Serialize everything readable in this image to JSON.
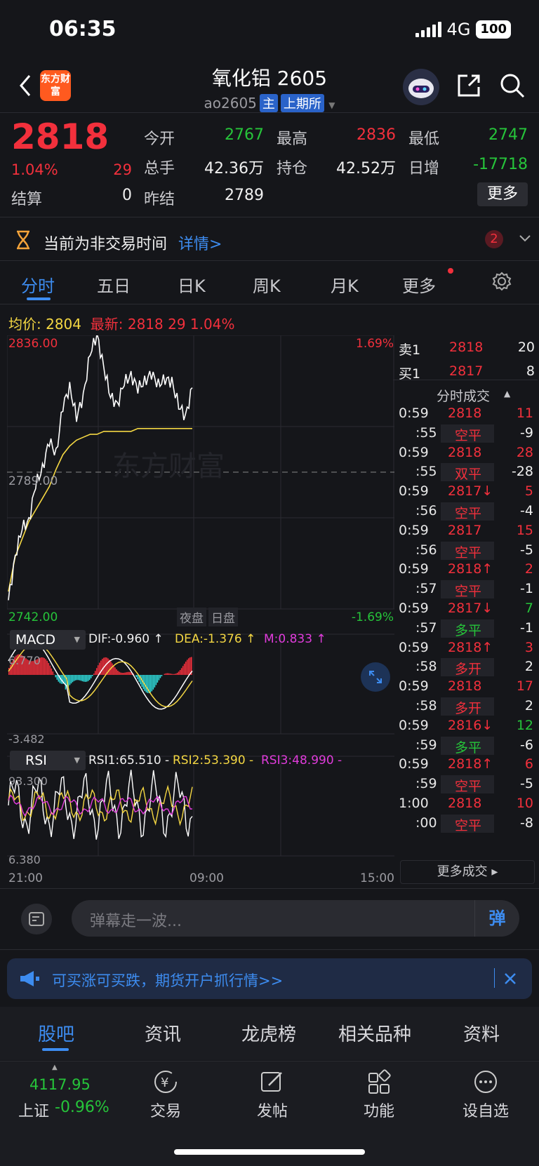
{
  "status_bar": {
    "time": "06:35",
    "network": "4G",
    "battery": "100"
  },
  "header": {
    "logo_text": "东方财富",
    "title": "氧化铝 2605",
    "code": "ao2605",
    "tag_main": "主",
    "tag_exchange": "上期所"
  },
  "quote": {
    "price": "2818",
    "change_pct": "1.04%",
    "change": "29",
    "settle_label": "结算",
    "settle_value": "0",
    "open_label": "今开",
    "open_value": "2767",
    "high_label": "最高",
    "high_value": "2836",
    "low_label": "最低",
    "low_value": "2747",
    "volume_label": "总手",
    "volume_value": "42.36万",
    "oi_label": "持仓",
    "oi_value": "42.52万",
    "daily_inc_label": "日增",
    "daily_inc_value": "-17718",
    "prev_settle_label": "昨结",
    "prev_settle_value": "2789",
    "more_label": "更多"
  },
  "notice": {
    "text": "当前为非交易时间",
    "link": "详情>",
    "badge": "2"
  },
  "tabs": [
    "分时",
    "五日",
    "日K",
    "周K",
    "月K",
    "更多"
  ],
  "avg_line": {
    "avg_label": "均价:",
    "avg_value": "2804",
    "latest_label": "最新:",
    "latest_value": "2818",
    "latest_change": "29",
    "latest_pct": "1.04%"
  },
  "chart": {
    "y_high": "2836.00",
    "y_mid": "2789.00",
    "y_low": "2742.00",
    "pct_high": "1.69%",
    "pct_low": "-1.69%",
    "night_label": "夜盘",
    "day_label": "日盘",
    "watermark": "东方财富",
    "time_labels": [
      "21:00",
      "09:00",
      "15:00"
    ],
    "macd": {
      "selector": "MACD",
      "dif": "DIF:-0.960 ↑",
      "dea": "DEA:-1.376 ↑",
      "m": "M:0.833 ↑",
      "y_high": "6.770",
      "y_low": "-3.482"
    },
    "rsi": {
      "selector": "RSI",
      "rsi1": "RSI1:65.510 -",
      "rsi2": "RSI2:53.390 -",
      "rsi3": "RSI3:48.990 -",
      "y_high": "93.300",
      "y_low": "6.380"
    },
    "colors": {
      "price": "#ffffff",
      "avg": "#f4d743",
      "up": "#f2303c",
      "down": "#2fd7d7",
      "rsi3": "#e13cdc"
    }
  },
  "chart_data": {
    "type": "line",
    "title": "",
    "y_range": [
      2742.0,
      2836.0
    ],
    "ref_price": 2789.0,
    "x_labels": [
      "21:00",
      "09:00",
      "15:00"
    ],
    "series": [
      {
        "values": [
          2745,
          2760,
          2770,
          2772,
          2785,
          2790,
          2800,
          2795,
          2812,
          2818,
          2808,
          2815,
          2830,
          2836,
          2825,
          2815,
          2812,
          2820,
          2822,
          2818,
          2820,
          2823,
          2819,
          2821,
          2820,
          2812,
          2808,
          2818
        ]
      },
      {
        "values": [
          2748,
          2760,
          2766,
          2772,
          2776,
          2780,
          2784,
          2790,
          2795,
          2798,
          2800,
          2801,
          2802,
          2802,
          2803,
          2803,
          2803,
          2803,
          2803,
          2804,
          2804,
          2804,
          2804,
          2804,
          2804,
          2804,
          2804,
          2804
        ]
      }
    ]
  },
  "order_book": {
    "sell_label": "卖1",
    "sell_price": "2818",
    "sell_vol": "20",
    "buy_label": "买1",
    "buy_price": "2817",
    "buy_vol": "8",
    "ticks_title": "分时成交",
    "ticks": [
      {
        "t": "0:59",
        "p": "2818",
        "pc": "red",
        "v": "11",
        "vc": "red",
        "kind": "primary"
      },
      {
        "t": ":55",
        "p": "空平",
        "pc": "red",
        "v": "-9",
        "vc": "white",
        "kind": "sub"
      },
      {
        "t": "0:59",
        "p": "2818",
        "pc": "red",
        "v": "28",
        "vc": "red",
        "kind": "primary"
      },
      {
        "t": ":55",
        "p": "双平",
        "pc": "red",
        "v": "-28",
        "vc": "white",
        "kind": "sub"
      },
      {
        "t": "0:59",
        "p": "2817↓",
        "pc": "red",
        "v": "5",
        "vc": "red",
        "kind": "primary"
      },
      {
        "t": ":56",
        "p": "空平",
        "pc": "red",
        "v": "-4",
        "vc": "white",
        "kind": "sub"
      },
      {
        "t": "0:59",
        "p": "2817",
        "pc": "red",
        "v": "15",
        "vc": "red",
        "kind": "primary"
      },
      {
        "t": ":56",
        "p": "空平",
        "pc": "red",
        "v": "-5",
        "vc": "white",
        "kind": "sub"
      },
      {
        "t": "0:59",
        "p": "2818↑",
        "pc": "red",
        "v": "2",
        "vc": "red",
        "kind": "primary"
      },
      {
        "t": ":57",
        "p": "空平",
        "pc": "red",
        "v": "-1",
        "vc": "white",
        "kind": "sub"
      },
      {
        "t": "0:59",
        "p": "2817↓",
        "pc": "red",
        "v": "7",
        "vc": "green",
        "kind": "primary"
      },
      {
        "t": ":57",
        "p": "多平",
        "pc": "green",
        "v": "-1",
        "vc": "white",
        "kind": "sub"
      },
      {
        "t": "0:59",
        "p": "2818↑",
        "pc": "red",
        "v": "3",
        "vc": "red",
        "kind": "primary"
      },
      {
        "t": ":58",
        "p": "多开",
        "pc": "red",
        "v": "2",
        "vc": "white",
        "kind": "sub"
      },
      {
        "t": "0:59",
        "p": "2818",
        "pc": "red",
        "v": "17",
        "vc": "red",
        "kind": "primary"
      },
      {
        "t": ":58",
        "p": "多开",
        "pc": "red",
        "v": "2",
        "vc": "white",
        "kind": "sub"
      },
      {
        "t": "0:59",
        "p": "2816↓",
        "pc": "red",
        "v": "12",
        "vc": "green",
        "kind": "primary"
      },
      {
        "t": ":59",
        "p": "多平",
        "pc": "green",
        "v": "-6",
        "vc": "white",
        "kind": "sub"
      },
      {
        "t": "0:59",
        "p": "2818↑",
        "pc": "red",
        "v": "6",
        "vc": "red",
        "kind": "primary"
      },
      {
        "t": ":59",
        "p": "空平",
        "pc": "red",
        "v": "-5",
        "vc": "white",
        "kind": "sub"
      },
      {
        "t": "1:00",
        "p": "2818",
        "pc": "red",
        "v": "10",
        "vc": "red",
        "kind": "primary"
      },
      {
        "t": ":00",
        "p": "空平",
        "pc": "red",
        "v": "-8",
        "vc": "white",
        "kind": "sub"
      }
    ],
    "more_ticks": "更多成交 ▸"
  },
  "comment": {
    "placeholder": "弹幕走一波...",
    "send_label": "弹"
  },
  "banner": {
    "text": "可买涨可买跌，期货开户抓行情>>"
  },
  "bottom_tabs": [
    "股吧",
    "资讯",
    "龙虎榜",
    "相关品种",
    "资料"
  ],
  "bottom_nav": {
    "index_value": "4117.95",
    "index_name": "上证",
    "index_change": "-0.96%",
    "items": [
      "交易",
      "发帖",
      "功能",
      "设自选"
    ]
  }
}
